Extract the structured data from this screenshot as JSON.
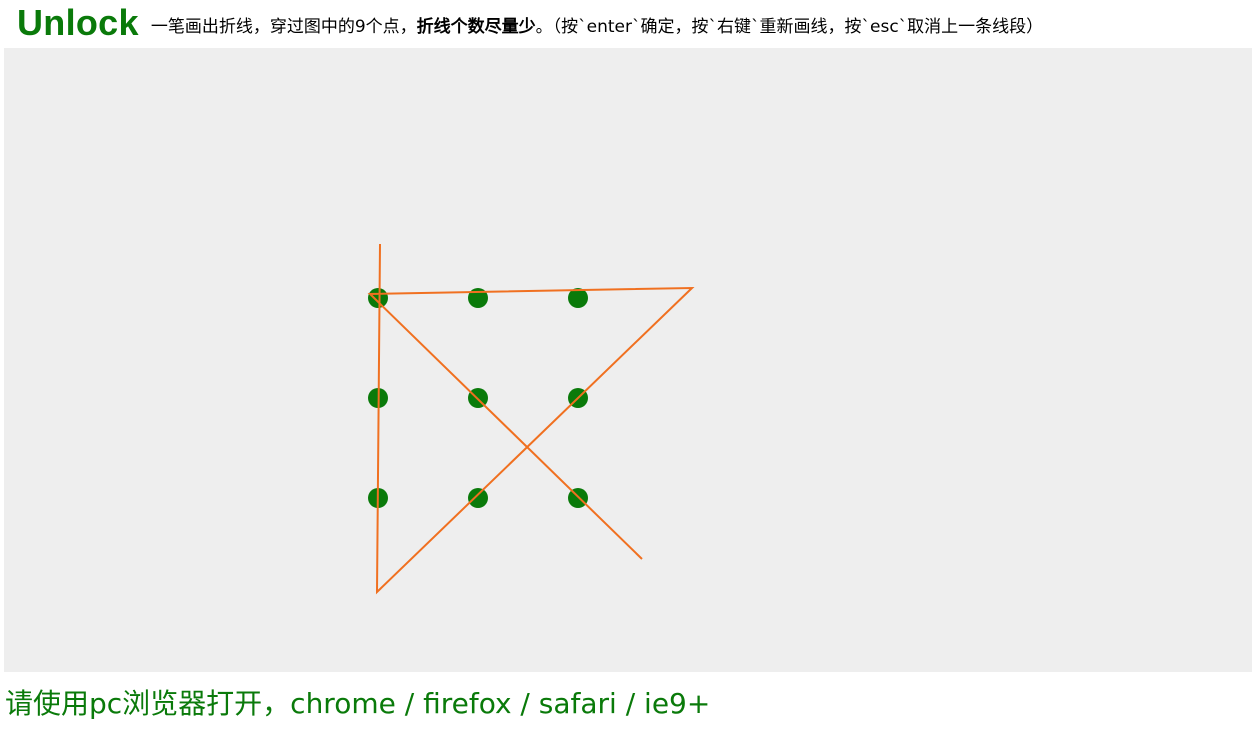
{
  "header": {
    "title": "Unlock",
    "instructions": {
      "part1": "一笔画出折线，穿过图中的9个点，",
      "emphasis": "折线个数尽量少",
      "part2": "。（按`enter`确定，按`右键`重新画线，按`esc`取消上一条线段）"
    }
  },
  "footer": {
    "browser_note": "请使用pc浏览器打开，chrome / firefox / safari / ie9+"
  },
  "colors": {
    "dot": "#0a7a0a",
    "line": "#f07020",
    "board_bg": "#eeeeee",
    "title": "#0a7a0a"
  }
}
